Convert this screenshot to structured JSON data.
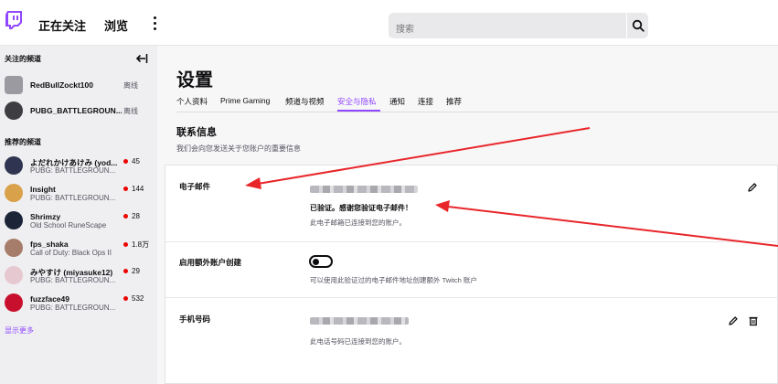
{
  "topbar": {
    "following": "正在关注",
    "browse": "浏览",
    "search_placeholder": "搜索"
  },
  "sidebar": {
    "followed_header": "关注的频道",
    "followed": [
      {
        "name": "RedBullZockt100",
        "status": "离线"
      },
      {
        "name": "PUBG_BATTLEGROUN...",
        "status": "离线"
      }
    ],
    "recommended_header": "推荐的频道",
    "recommended": [
      {
        "name": "よだれかけあけみ (yod...",
        "game": "PUBG: BATTLEGROUN...",
        "viewers": "45"
      },
      {
        "name": "Insight",
        "game": "PUBG: BATTLEGROUN...",
        "viewers": "144"
      },
      {
        "name": "Shrimzy",
        "game": "Old School RuneScape",
        "viewers": "28"
      },
      {
        "name": "fps_shaka",
        "game": "Call of Duty: Black Ops II",
        "viewers": "1.8万"
      },
      {
        "name": "みやすけ (miyasuke12)",
        "game": "PUBG: BATTLEGROUN...",
        "viewers": "29"
      },
      {
        "name": "fuzzface49",
        "game": "PUBG: BATTLEGROUN...",
        "viewers": "532"
      }
    ],
    "show_more": "显示更多"
  },
  "main": {
    "title": "设置",
    "tabs": [
      "个人资料",
      "Prime Gaming",
      "频道与视频",
      "安全与隐私",
      "通知",
      "连接",
      "推荐"
    ],
    "active_tab": "安全与隐私",
    "section_title": "联系信息",
    "section_subtitle": "我们会向您发送关于您账户的重要信息",
    "email": {
      "label": "电子邮件",
      "verified": "已验证。感谢您验证电子邮件！",
      "note": "此电子邮箱已连接到您的账户。"
    },
    "extra_accounts": {
      "label": "启用额外账户创建",
      "note": "可以使用此验证过的电子邮件地址创建额外 Twitch 账户"
    },
    "phone": {
      "label": "手机号码",
      "note": "此电话号码已连接到您的账户。"
    }
  },
  "colors": {
    "accent": "#9147ff",
    "live": "#eb0400",
    "annotation": "#e8262a"
  }
}
